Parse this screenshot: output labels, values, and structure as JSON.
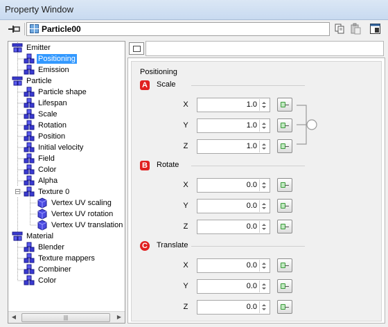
{
  "window": {
    "title": "Property Window"
  },
  "toolbar": {
    "object_name": "Particle00"
  },
  "tree": {
    "items": [
      {
        "label": "Emitter",
        "level": 0,
        "icon": "node-group-icon"
      },
      {
        "label": "Positioning",
        "level": 1,
        "icon": "node-leaf-icon",
        "selected": true
      },
      {
        "label": "Emission",
        "level": 1,
        "icon": "node-leaf-icon"
      },
      {
        "label": "Particle",
        "level": 0,
        "icon": "node-group-icon"
      },
      {
        "label": "Particle shape",
        "level": 1,
        "icon": "node-leaf-icon"
      },
      {
        "label": "Lifespan",
        "level": 1,
        "icon": "node-leaf-icon"
      },
      {
        "label": "Scale",
        "level": 1,
        "icon": "node-leaf-icon"
      },
      {
        "label": "Rotation",
        "level": 1,
        "icon": "node-leaf-icon"
      },
      {
        "label": "Position",
        "level": 1,
        "icon": "node-leaf-icon"
      },
      {
        "label": "Initial velocity",
        "level": 1,
        "icon": "node-leaf-icon"
      },
      {
        "label": "Field",
        "level": 1,
        "icon": "node-leaf-icon"
      },
      {
        "label": "Color",
        "level": 1,
        "icon": "node-leaf-icon"
      },
      {
        "label": "Alpha",
        "level": 1,
        "icon": "node-leaf-icon"
      },
      {
        "label": "Texture 0",
        "level": 1,
        "icon": "node-leaf-icon",
        "expander": "⊟"
      },
      {
        "label": "Vertex UV scaling",
        "level": 2,
        "icon": "cube-icon"
      },
      {
        "label": "Vertex UV rotation",
        "level": 2,
        "icon": "cube-icon"
      },
      {
        "label": "Vertex UV translation",
        "level": 2,
        "icon": "cube-icon"
      },
      {
        "label": "Material",
        "level": 0,
        "icon": "node-group-icon"
      },
      {
        "label": "Blender",
        "level": 1,
        "icon": "node-leaf-icon"
      },
      {
        "label": "Texture mappers",
        "level": 1,
        "icon": "node-leaf-icon"
      },
      {
        "label": "Combiner",
        "level": 1,
        "icon": "node-leaf-icon"
      },
      {
        "label": "Color",
        "level": 1,
        "icon": "node-leaf-icon"
      }
    ],
    "scroll_thumb": "|||"
  },
  "panel": {
    "group_title": "Positioning",
    "sections": [
      {
        "badge": "A",
        "label": "Scale",
        "fields": [
          {
            "axis": "X",
            "value": "1.0"
          },
          {
            "axis": "Y",
            "value": "1.0"
          },
          {
            "axis": "Z",
            "value": "1.0"
          }
        ]
      },
      {
        "badge": "B",
        "label": "Rotate",
        "fields": [
          {
            "axis": "X",
            "value": "0.0"
          },
          {
            "axis": "Y",
            "value": "0.0"
          },
          {
            "axis": "Z",
            "value": "0.0"
          }
        ]
      },
      {
        "badge": "C",
        "label": "Translate",
        "fields": [
          {
            "axis": "X",
            "value": "0.0"
          },
          {
            "axis": "Y",
            "value": "0.0"
          },
          {
            "axis": "Z",
            "value": "0.0"
          }
        ]
      }
    ]
  },
  "colors": {
    "badge": "#e02020",
    "selection": "#3399ff",
    "node_icon": "#3a3ad0"
  }
}
